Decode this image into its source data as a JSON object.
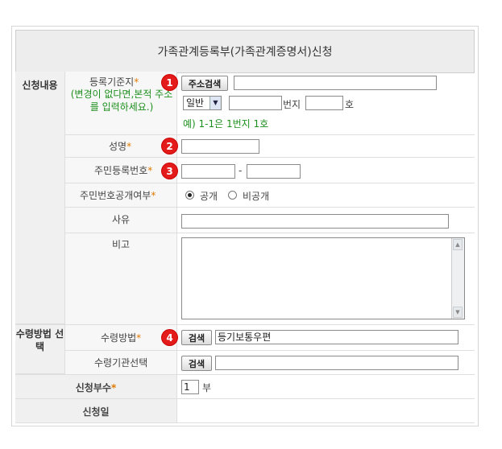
{
  "form": {
    "title": "가족관계등록부(가족관계증명서)신청",
    "sections": {
      "apply_content": "신청내용",
      "receive_method": "수령방법 선택"
    },
    "fields": {
      "reg_base": {
        "label": "등록기준지",
        "hint_line1": "(변경이 없다면,본적 주소",
        "hint_line2": "를 입력하세요.)",
        "address_search_button": "주소검색",
        "address_value": "",
        "type_select_value": "일반",
        "bunji_label": "번지",
        "ho_label": "호",
        "example": "예) 1-1은 1번지 1호"
      },
      "name": {
        "label": "성명",
        "value": ""
      },
      "resident_no": {
        "label": "주민등록번호",
        "separator": "-"
      },
      "resident_public": {
        "label": "주민번호공개여부",
        "option_public": "공개",
        "option_private": "비공개",
        "selected": "public"
      },
      "reason": {
        "label": "사유",
        "value": ""
      },
      "note": {
        "label": "비고",
        "value": ""
      },
      "receive_method": {
        "label": "수령방법",
        "search_button": "검색",
        "value": "등기보통우편"
      },
      "receive_org": {
        "label": "수령기관선택",
        "search_button": "검색",
        "value": ""
      },
      "copies": {
        "label": "신청부수",
        "value": "1",
        "unit": "부"
      },
      "apply_date": {
        "label": "신청일"
      }
    },
    "required_mark": "*",
    "badges": [
      "1",
      "2",
      "3",
      "4"
    ]
  }
}
